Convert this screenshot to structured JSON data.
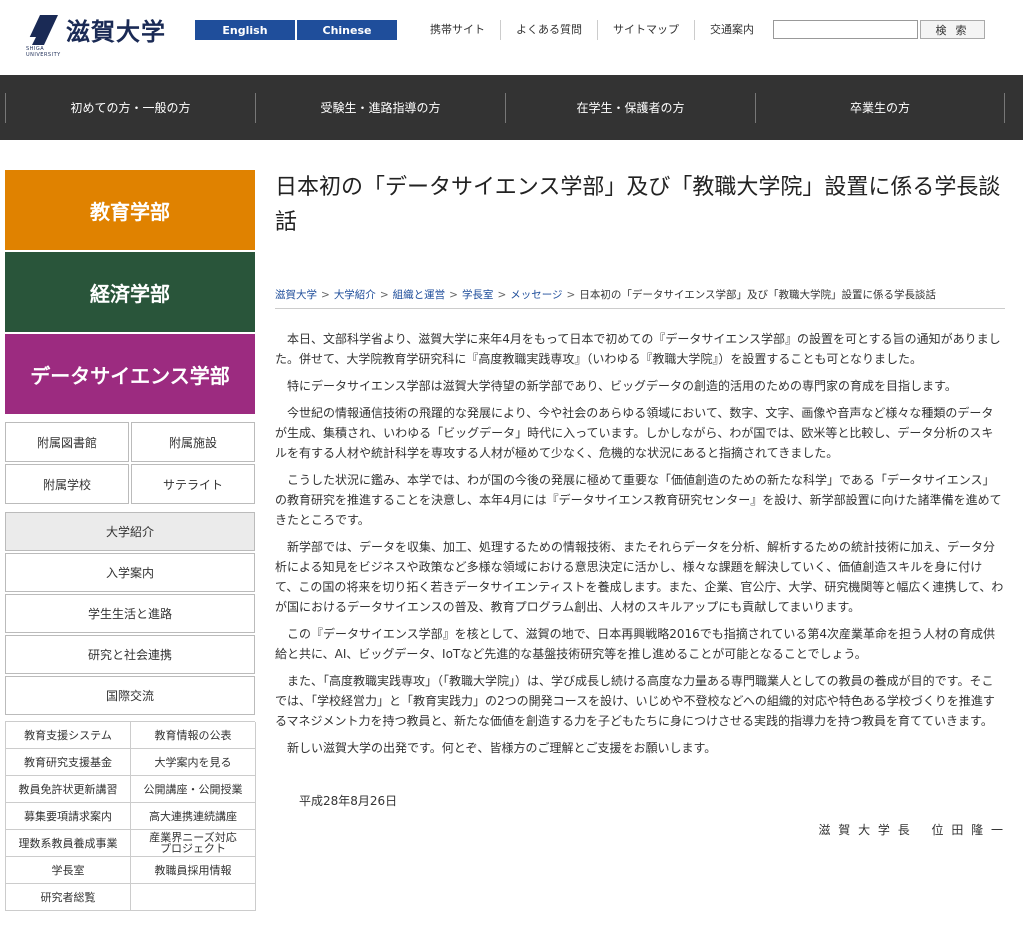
{
  "header": {
    "logo_text": "滋賀大学",
    "logo_sub": "SHIGA UNIVERSITY",
    "lang": [
      "English",
      "Chinese"
    ],
    "util_links": [
      "携帯サイト",
      "よくある質問",
      "サイトマップ",
      "交通案内"
    ],
    "search_placeholder": "",
    "search_label": "検 索"
  },
  "gnav": [
    "初めての方・一般の方",
    "受験生・進路指導の方",
    "在学生・保護者の方",
    "卒業生の方"
  ],
  "sidebar": {
    "banners": [
      {
        "label": "教育学部",
        "color": "#e08200"
      },
      {
        "label": "経済学部",
        "color": "#29553a"
      },
      {
        "label": "データサイエンス学部",
        "color": "#9c2b80"
      }
    ],
    "facilities": [
      "附属図書館",
      "附属施設",
      "附属学校",
      "サテライト"
    ],
    "menu": [
      "大学紹介",
      "入学案内",
      "学生生活と進路",
      "研究と社会連携",
      "国際交流"
    ],
    "links": [
      "教育支援システム",
      "教育情報の公表",
      "教育研究支援基金",
      "大学案内を見る",
      "教員免許状更新講習",
      "公開講座・公開授業",
      "募集要項請求案内",
      "高大連携連続講座",
      "理数系教員養成事業",
      "産業界ニーズ対応プロジェクト",
      "学長室",
      "教職員採用情報",
      "研究者総覧",
      ""
    ]
  },
  "main": {
    "title": "日本初の「データサイエンス学部」及び「教職大学院」設置に係る学長談話",
    "breadcrumb": [
      "滋賀大学",
      "大学紹介",
      "組織と運営",
      "学長室",
      "メッセージ"
    ],
    "breadcrumb_current": "日本初の「データサイエンス学部」及び「教職大学院」設置に係る学長談話",
    "paragraphs": [
      "本日、文部科学省より、滋賀大学に来年4月をもって日本で初めての『データサイエンス学部』の設置を可とする旨の通知がありました。併せて、大学院教育学研究科に『高度教職実践専攻』（いわゆる『教職大学院』）を設置することも可となりました。",
      "特にデータサイエンス学部は滋賀大学待望の新学部であり、ビッグデータの創造的活用のための専門家の育成を目指します。",
      "今世紀の情報通信技術の飛躍的な発展により、今や社会のあらゆる領域において、数字、文字、画像や音声など様々な種類のデータが生成、集積され、いわゆる「ビッグデータ」時代に入っています。しかしながら、わが国では、欧米等と比較し、データ分析のスキルを有する人材や統計科学を専攻する人材が極めて少なく、危機的な状況にあると指摘されてきました。",
      "こうした状況に鑑み、本学では、わが国の今後の発展に極めて重要な「価値創造のための新たな科学」である「データサイエンス」の教育研究を推進することを決意し、本年4月には『データサイエンス教育研究センター』を設け、新学部設置に向けた諸準備を進めてきたところです。",
      "新学部では、データを収集、加工、処理するための情報技術、またそれらデータを分析、解析するための統計技術に加え、データ分析による知見をビジネスや政策など多様な領域における意思決定に活かし、様々な課題を解決していく、価値創造スキルを身に付けて、この国の将来を切り拓く若きデータサイエンティストを養成します。また、企業、官公庁、大学、研究機関等と幅広く連携して、わが国におけるデータサイエンスの普及、教育プログラム創出、人材のスキルアップにも貢献してまいります。",
      "この『データサイエンス学部』を核として、滋賀の地で、日本再興戦略2016でも指摘されている第4次産業革命を担う人材の育成供給と共に、AI、ビッグデータ、IoTなど先進的な基盤技術研究等を推し進めることが可能となることでしょう。",
      "また、「高度教職実践専攻」（「教職大学院」）は、学び成長し続ける高度な力量ある専門職業人としての教員の養成が目的です。そこでは、「学校経営力」と「教育実践力」の2つの開発コースを設け、いじめや不登校などへの組織的対応や特色ある学校づくりを推進するマネジメント力を持つ教員と、新たな価値を創造する力を子どもたちに身につけさせる実践的指導力を持つ教員を育てていきます。",
      "新しい滋賀大学の出発です。何とぞ、皆様方のご理解とご支援をお願いします。"
    ],
    "date": "平成28年8月26日",
    "signature": "滋 賀 大 学 長　 位 田 隆 一"
  }
}
